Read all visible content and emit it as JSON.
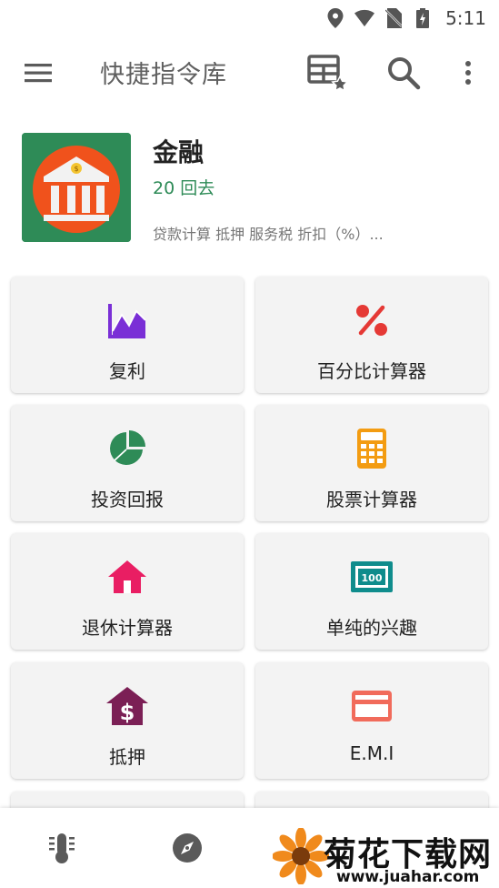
{
  "status_bar": {
    "time": "5:11"
  },
  "app_bar": {
    "title": "快捷指令库"
  },
  "category": {
    "title": "金融",
    "count": "20 回去",
    "description": "贷款计算 抵押 服务税 折扣（%）...",
    "image_bg_color": "#2e8b57",
    "image_circle_color": "#f0521c"
  },
  "tools": [
    {
      "label": "复利",
      "icon": "chart-line-icon",
      "color": "#7a2fd6"
    },
    {
      "label": "百分比计算器",
      "icon": "percent-icon",
      "color": "#e53935"
    },
    {
      "label": "投资回报",
      "icon": "pie-chart-icon",
      "color": "#2e8b57"
    },
    {
      "label": "股票计算器",
      "icon": "calculator-icon",
      "color": "#f39c12"
    },
    {
      "label": "退休计算器",
      "icon": "home-icon",
      "color": "#e91e63"
    },
    {
      "label": "单纯的兴趣",
      "icon": "cash-icon",
      "color": "#0f8c8c"
    },
    {
      "label": "抵押",
      "icon": "house-dollar-icon",
      "color": "#7b1f55"
    },
    {
      "label": "E.M.I",
      "icon": "credit-card-icon",
      "color": "#f16b5b"
    }
  ],
  "bottom_nav": {
    "items": [
      "thermometer-icon",
      "compass-icon"
    ]
  },
  "watermark": {
    "text": "菊花下载网",
    "url": "www.juahar.com"
  }
}
